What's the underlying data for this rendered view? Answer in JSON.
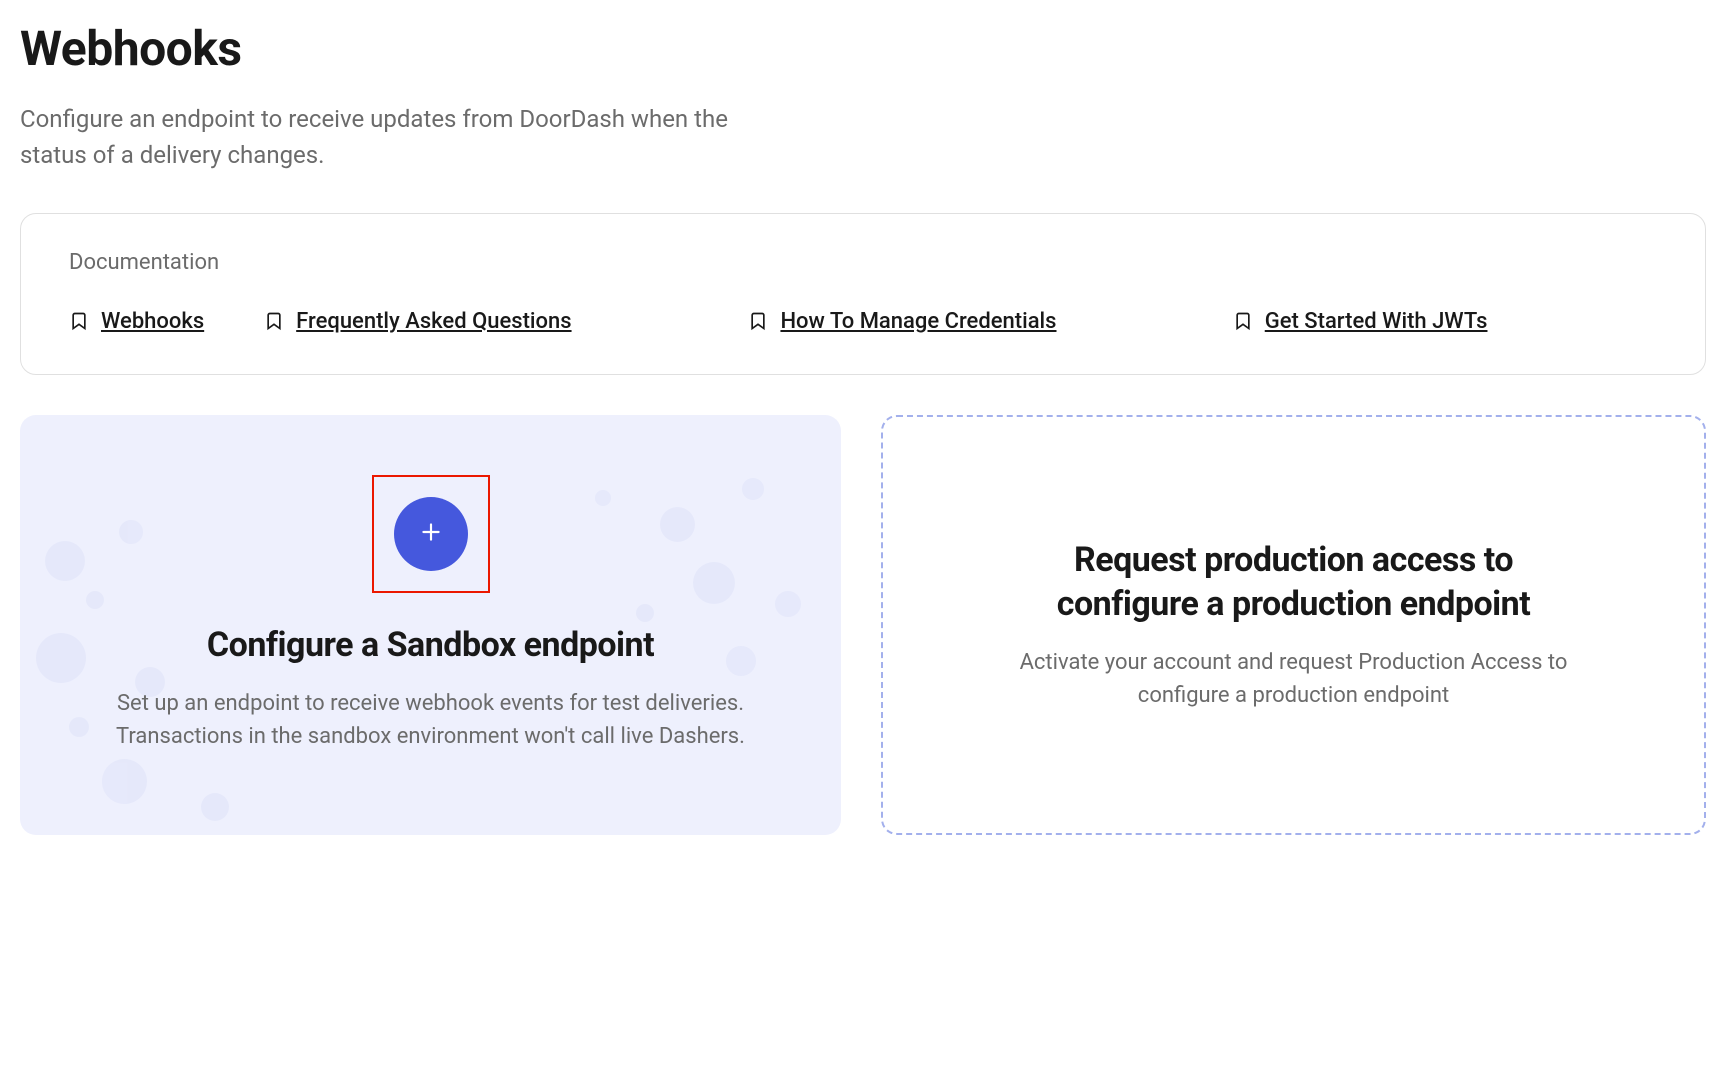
{
  "header": {
    "title": "Webhooks",
    "subtitle": "Configure an endpoint to receive updates from DoorDash when the status of a delivery changes."
  },
  "documentation": {
    "title": "Documentation",
    "links": [
      {
        "label": "Webhooks"
      },
      {
        "label": "Frequently Asked Questions"
      },
      {
        "label": "How To Manage Credentials"
      },
      {
        "label": "Get Started With JWTs"
      }
    ]
  },
  "cards": {
    "sandbox": {
      "title": "Configure a Sandbox endpoint",
      "description": "Set up an endpoint to receive webhook events for test deliveries. Transactions in the sandbox environment won't call live Dashers."
    },
    "production": {
      "title": "Request production access to configure a production endpoint",
      "description": "Activate your account and request Production Access to configure a production endpoint"
    }
  }
}
